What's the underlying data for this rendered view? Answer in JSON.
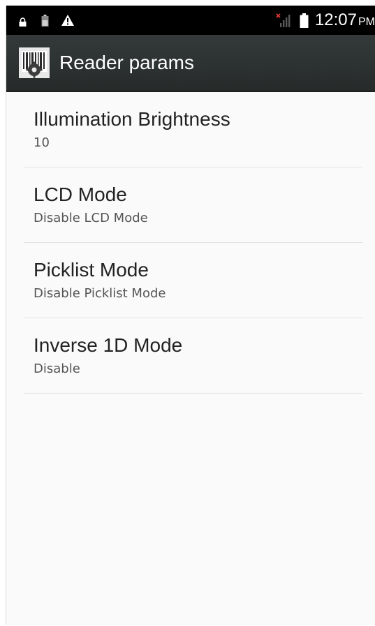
{
  "status_bar": {
    "icons_left": [
      "lock-icon",
      "battery-small-icon",
      "warning-icon"
    ],
    "icons_right": [
      "signal-no-sim-icon",
      "battery-icon"
    ],
    "time": "12:07",
    "ampm": "PM",
    "signal_x_color": "#e53935"
  },
  "action_bar": {
    "app_icon": "barcode-settings-icon",
    "title": "Reader params"
  },
  "preferences": [
    {
      "title": "Illumination Brightness",
      "summary": "10"
    },
    {
      "title": "LCD Mode",
      "summary": "Disable LCD Mode"
    },
    {
      "title": "Picklist Mode",
      "summary": "Disable Picklist Mode"
    },
    {
      "title": "Inverse 1D Mode",
      "summary": "Disable"
    }
  ]
}
